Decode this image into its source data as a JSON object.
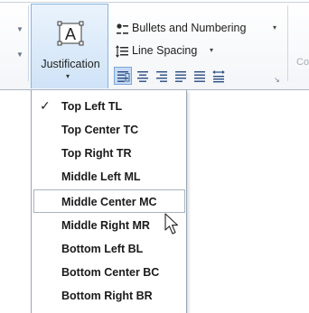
{
  "ribbon": {
    "justification_label": "Justification",
    "justification_glyph": "A",
    "bullets_label": "Bullets and Numbering",
    "line_spacing_label": "Line Spacing",
    "dropdown_glyph": "▾",
    "right_cutoff_text": "Co",
    "launcher_glyph": "↘"
  },
  "menu": {
    "items": [
      {
        "label": "Top Left TL",
        "checked": true
      },
      {
        "label": "Top Center TC"
      },
      {
        "label": "Top Right TR"
      },
      {
        "label": "Middle Left ML"
      },
      {
        "label": "Middle Center MC",
        "hovered": true
      },
      {
        "label": "Middle Right MR"
      },
      {
        "label": "Bottom Left BL"
      },
      {
        "label": "Bottom Center BC"
      },
      {
        "label": "Bottom Right BR"
      }
    ],
    "check_glyph": "✓"
  },
  "colors": {
    "accent_blue": "#86b5e4",
    "active_button_bg": "#c6dbf3",
    "hover_border": "#a9b3bf"
  }
}
